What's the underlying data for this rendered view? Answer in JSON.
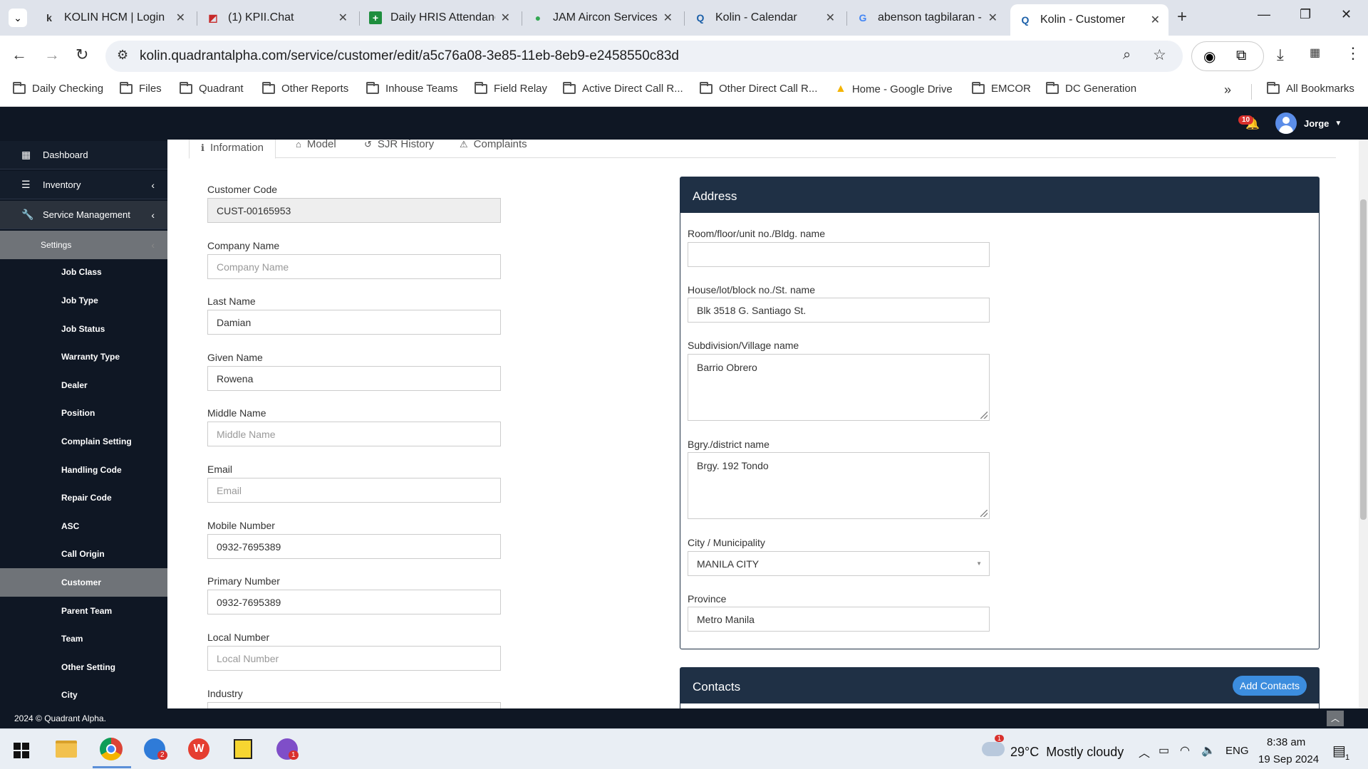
{
  "browser": {
    "tabs": [
      {
        "title": "KOLIN HCM | Login",
        "icon": "k-logo-icon"
      },
      {
        "title": "(1) KPII.Chat",
        "icon": "chat-icon"
      },
      {
        "title": "Daily HRIS Attendanc",
        "icon": "sheets-icon"
      },
      {
        "title": "JAM Aircon Services",
        "icon": "map-pin-icon"
      },
      {
        "title": "Kolin - Calendar",
        "icon": "q-logo-icon"
      },
      {
        "title": "abenson tagbilaran -",
        "icon": "google-icon"
      },
      {
        "title": "Kolin - Customer",
        "icon": "q-logo-icon"
      }
    ],
    "url": "kolin.quadrantalpha.com/service/customer/edit/a5c76a08-3e85-11eb-8eb9-e2458550c83d",
    "bookmarks": [
      "Daily Checking",
      "Files",
      "Quadrant",
      "Other Reports",
      "Inhouse Teams",
      "Field Relay",
      "Active Direct Call R...",
      "Other Direct Call R...",
      "Home - Google Drive",
      "EMCOR",
      "DC Generation"
    ],
    "all_bookmarks": "All Bookmarks"
  },
  "header": {
    "notification_count": "10",
    "user_name": "Jorge"
  },
  "sidebar": {
    "top_items": [
      "Dashboard",
      "Inventory",
      "Service Management"
    ],
    "settings_label": "Settings",
    "sub_items": [
      "Job Class",
      "Job Type",
      "Job Status",
      "Warranty Type",
      "Dealer",
      "Position",
      "Complain Setting",
      "Handling Code",
      "Repair Code",
      "ASC",
      "Call Origin",
      "Customer",
      "Parent Team",
      "Team",
      "Other Setting",
      "City"
    ]
  },
  "content_tabs": [
    "Information",
    "Model",
    "SJR History",
    "Complaints"
  ],
  "form": {
    "customer_code": {
      "label": "Customer Code",
      "value": "CUST-00165953"
    },
    "company_name": {
      "label": "Company Name",
      "placeholder": "Company Name"
    },
    "last_name": {
      "label": "Last Name",
      "value": "Damian"
    },
    "given_name": {
      "label": "Given Name",
      "value": "Rowena"
    },
    "middle_name": {
      "label": "Middle Name",
      "placeholder": "Middle Name"
    },
    "email": {
      "label": "Email",
      "placeholder": "Email"
    },
    "mobile_number": {
      "label": "Mobile Number",
      "value": "0932-7695389"
    },
    "primary_number": {
      "label": "Primary Number",
      "value": "0932-7695389"
    },
    "local_number": {
      "label": "Local Number",
      "placeholder": "Local Number"
    },
    "industry": {
      "label": "Industry"
    }
  },
  "address": {
    "title": "Address",
    "room": {
      "label": "Room/floor/unit no./Bldg. name",
      "value": ""
    },
    "house": {
      "label": "House/lot/block no./St. name",
      "value": "Blk 3518 G. Santiago St."
    },
    "subdivision": {
      "label": "Subdivision/Village name",
      "value": "Barrio Obrero"
    },
    "barangay": {
      "label": "Bgry./district name",
      "value": "Brgy. 192 Tondo"
    },
    "city": {
      "label": "City / Municipality",
      "value": "MANILA CITY"
    },
    "province": {
      "label": "Province",
      "value": "Metro Manila"
    }
  },
  "contacts": {
    "title": "Contacts",
    "add_button": "Add Contacts"
  },
  "footer": {
    "text": "2024 © Quadrant Alpha."
  },
  "taskbar": {
    "weather": "29°C  Mostly cloudy",
    "weather_badge": "1",
    "language": "ENG",
    "time": "8:38 am",
    "date": "19 Sep 2024",
    "notification_count": "1",
    "chrome_badge": "2",
    "viber_badge": "1"
  }
}
